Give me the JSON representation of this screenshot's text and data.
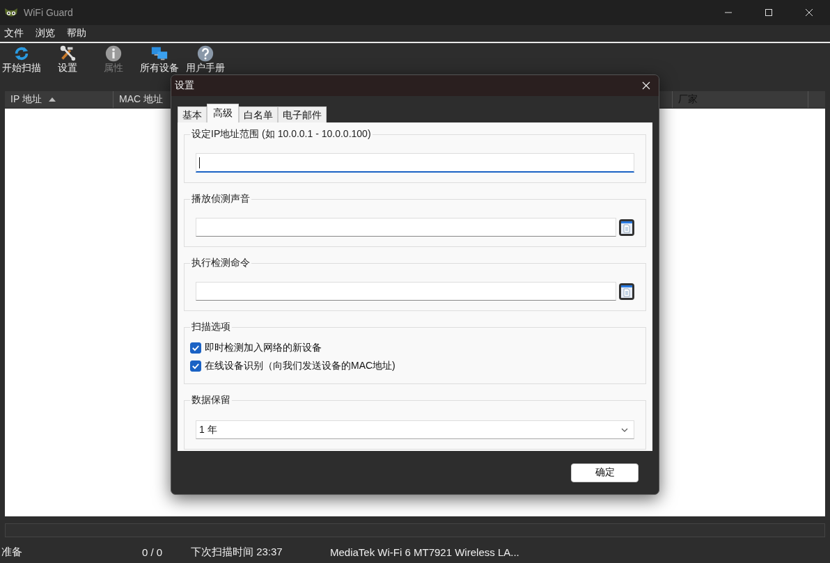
{
  "window": {
    "title": "WiFi Guard"
  },
  "menu": [
    "文件",
    "浏览",
    "帮助"
  ],
  "toolbar": [
    {
      "label": "开始扫描",
      "kind": "scan",
      "disabled": false
    },
    {
      "label": "设置",
      "kind": "tools",
      "disabled": false
    },
    {
      "label": "属性",
      "kind": "info",
      "disabled": true
    },
    {
      "label": "所有设备",
      "kind": "devices",
      "disabled": false
    },
    {
      "label": "用户手册",
      "kind": "help",
      "disabled": false
    }
  ],
  "table": {
    "columns": [
      {
        "label": "IP 地址",
        "sorted": true
      },
      {
        "label": "MAC 地址",
        "sorted": false
      },
      {
        "label": "厂家",
        "sorted": false
      }
    ]
  },
  "progress": {
    "level": 0
  },
  "status_bar": [
    "准备",
    "0 / 0",
    "下次扫描时间 23:37",
    "MediaTek Wi-Fi 6 MT7921 Wireless LA..."
  ],
  "dialog": {
    "title": "设置",
    "tabs": [
      {
        "label": "基本",
        "selected": false
      },
      {
        "label": "高级",
        "selected": true
      },
      {
        "label": "白名单",
        "selected": false
      },
      {
        "label": "电子邮件",
        "selected": false
      }
    ],
    "groups": [
      {
        "kind": "input",
        "title": "设定IP地址范围 (如 10.0.0.1 - 10.0.0.100)",
        "focused": true,
        "browse": false
      },
      {
        "kind": "input",
        "title": "播放侦测声音",
        "focused": false,
        "browse": true
      },
      {
        "kind": "input",
        "title": "执行检测命令",
        "focused": false,
        "browse": true
      },
      {
        "kind": "checkboxes",
        "title": "扫描选项",
        "items": [
          {
            "label": "即时检测加入网络的新设备",
            "checked": true
          },
          {
            "label": "在线设备识别（向我们发送设备的MAC地址)",
            "checked": true
          }
        ]
      },
      {
        "kind": "select",
        "title": "数据保留",
        "value": "1 年"
      }
    ],
    "ok": "确定"
  }
}
